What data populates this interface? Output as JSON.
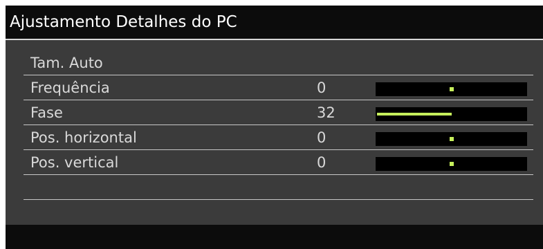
{
  "window": {
    "title": "Ajustamento Detalhes do PC"
  },
  "menu": {
    "auto_size": {
      "label": "Tam. Auto"
    },
    "frequency": {
      "label": "Frequência",
      "value": "0",
      "slider_fraction": 0.5,
      "slider_style": "center-marker"
    },
    "phase": {
      "label": "Fase",
      "value": "32",
      "slider_fraction": 0.5,
      "slider_style": "fill"
    },
    "h_position": {
      "label": "Pos. horizontal",
      "value": "0",
      "slider_fraction": 0.5,
      "slider_style": "center-marker"
    },
    "v_position": {
      "label": "Pos. vertical",
      "value": "0",
      "slider_fraction": 0.5,
      "slider_style": "center-marker"
    }
  },
  "colors": {
    "panel_background": "#3b3b3b",
    "title_background": "#0c0c0c",
    "slider_track": "#000000",
    "slider_accent": "#c6ef5c",
    "text": "#d9d9d9"
  }
}
